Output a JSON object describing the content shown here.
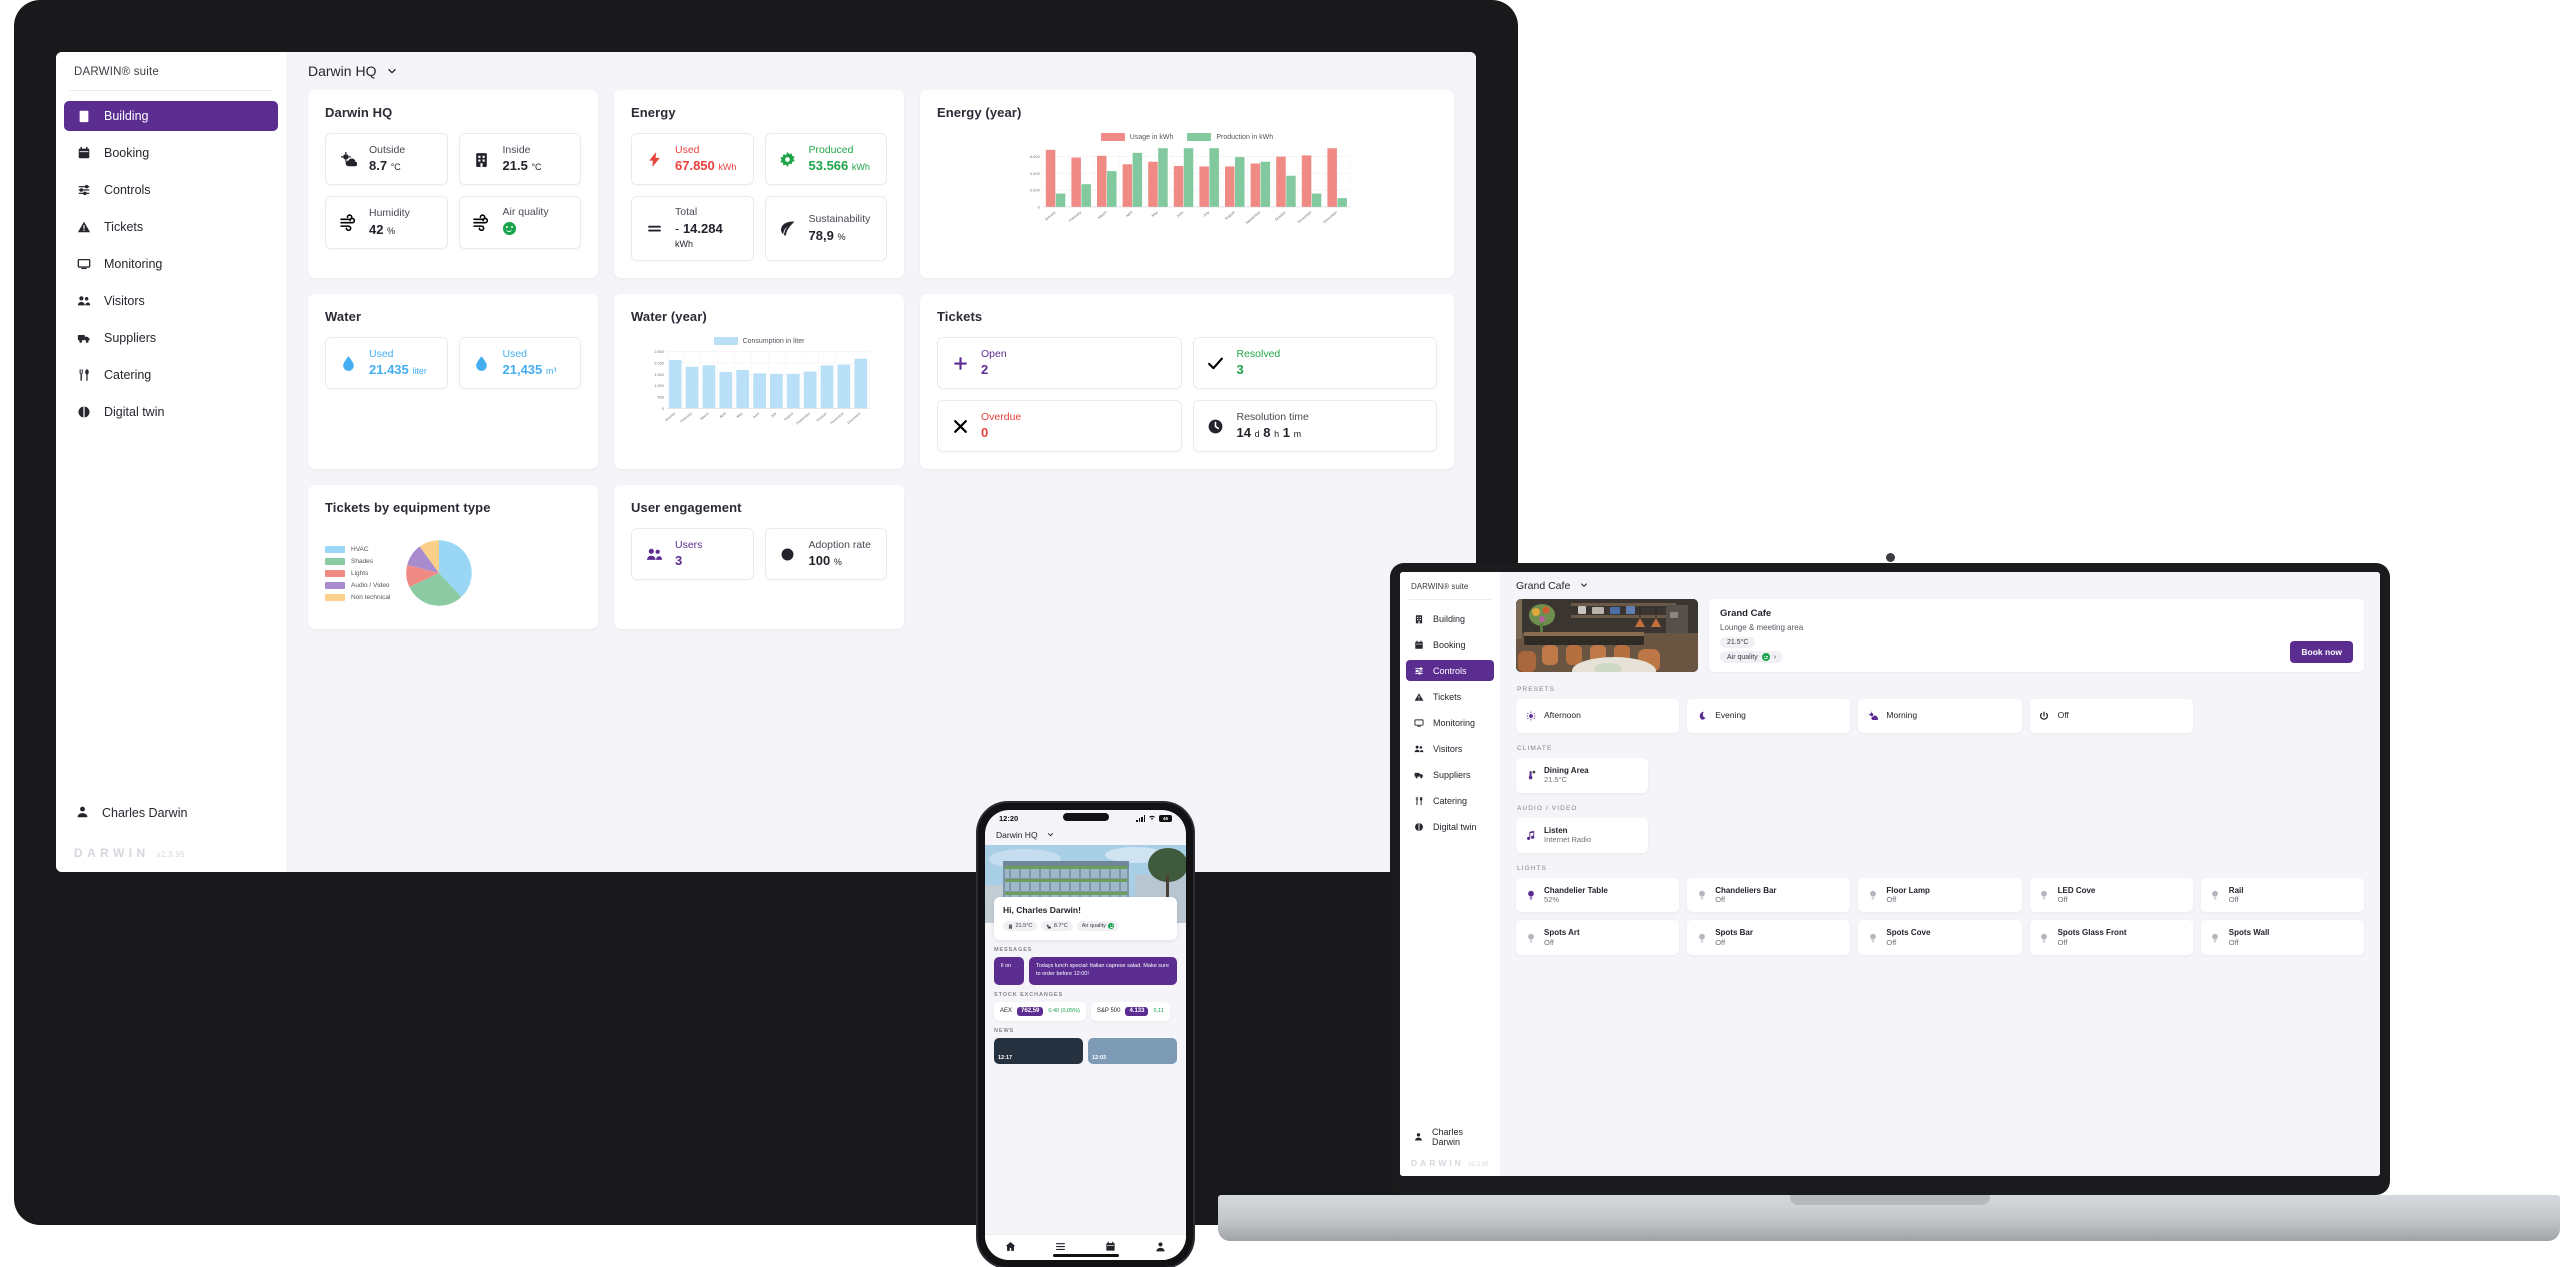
{
  "brand": {
    "suite": "DARWIN® suite",
    "watermark": "DARWIN",
    "version": "v2.3.95"
  },
  "desktop": {
    "nav": [
      {
        "label": "Building",
        "icon": "building-icon",
        "active": true
      },
      {
        "label": "Booking",
        "icon": "calendar-icon",
        "active": false
      },
      {
        "label": "Controls",
        "icon": "sliders-icon",
        "active": false
      },
      {
        "label": "Tickets",
        "icon": "warning-icon",
        "active": false
      },
      {
        "label": "Monitoring",
        "icon": "monitor-icon",
        "active": false
      },
      {
        "label": "Visitors",
        "icon": "users-icon",
        "active": false
      },
      {
        "label": "Suppliers",
        "icon": "truck-icon",
        "active": false
      },
      {
        "label": "Catering",
        "icon": "cutlery-icon",
        "active": false
      },
      {
        "label": "Digital twin",
        "icon": "digital-twin-icon",
        "active": false
      }
    ],
    "user": "Charles Darwin",
    "topbar": {
      "title": "Darwin HQ"
    },
    "cards": {
      "darwin_hq": {
        "title": "Darwin HQ",
        "tiles": [
          {
            "label": "Outside",
            "value": "8.7",
            "unit": "°C",
            "icon": "weather-icon",
            "color": "dark"
          },
          {
            "label": "Inside",
            "value": "21.5",
            "unit": "°C",
            "icon": "building-icon",
            "color": "dark"
          },
          {
            "label": "Humidity",
            "value": "42",
            "unit": "%",
            "icon": "wind-icon",
            "color": "dark"
          },
          {
            "label": "Air quality",
            "value": "",
            "unit": "",
            "icon": "wind-icon",
            "color": "dark",
            "badge": "smiley-green"
          }
        ]
      },
      "energy": {
        "title": "Energy",
        "tiles": [
          {
            "label": "Used",
            "value": "67.850",
            "unit": "kWh",
            "icon": "bolt-icon",
            "color": "red"
          },
          {
            "label": "Produced",
            "value": "53.566",
            "unit": "kWh",
            "icon": "gear-icon",
            "color": "green"
          },
          {
            "label": "Total",
            "value": "14.284",
            "unit": "kWh",
            "icon": "equals-icon",
            "color": "dark",
            "prefix": "-"
          },
          {
            "label": "Sustainability",
            "value": "78,9",
            "unit": "%",
            "icon": "leaf-icon",
            "color": "dark"
          }
        ]
      },
      "water": {
        "title": "Water",
        "tiles": [
          {
            "label": "Used",
            "value": "21.435",
            "unit": "liter",
            "icon": "droplet-icon",
            "color": "blue"
          },
          {
            "label": "Used",
            "value": "21,435",
            "unit": "m³",
            "icon": "droplet-icon",
            "color": "blue"
          }
        ]
      },
      "tickets": {
        "title": "Tickets",
        "tiles": [
          {
            "label": "Open",
            "value": "2",
            "unit": "",
            "icon": "plus-icon",
            "color": "purple"
          },
          {
            "label": "Resolved",
            "value": "3",
            "unit": "",
            "icon": "check-icon",
            "color": "green"
          },
          {
            "label": "Overdue",
            "value": "0",
            "unit": "",
            "icon": "cross-icon",
            "color": "red"
          },
          {
            "label": "Resolution time",
            "value": "14",
            "unit": "d 8 h 1 m",
            "icon": "clock-icon",
            "color": "dark",
            "composite": "14 d 8 h 1 m"
          }
        ]
      },
      "user_engagement": {
        "title": "User engagement",
        "tiles": [
          {
            "label": "Users",
            "value": "3",
            "unit": "",
            "icon": "users-icon",
            "color": "purple"
          },
          {
            "label": "Adoption rate",
            "value": "100",
            "unit": "%",
            "icon": "circle-icon",
            "color": "dark"
          }
        ]
      },
      "energy_year": {
        "title": "Energy (year)"
      },
      "water_year": {
        "title": "Water (year)"
      },
      "tickets_pie": {
        "title": "Tickets by equipment type"
      }
    }
  },
  "chart_data": [
    {
      "type": "bar",
      "title": "Energy (year)",
      "categories": [
        "January",
        "February",
        "March",
        "April",
        "May",
        "June",
        "July",
        "August",
        "September",
        "October",
        "November",
        "December"
      ],
      "series": [
        {
          "name": "Usage in kWh",
          "color": "#ef8a85",
          "values": [
            6750,
            5850,
            6050,
            5050,
            5350,
            4850,
            4800,
            4800,
            5150,
            5950,
            6100,
            6950
          ]
        },
        {
          "name": "Production in kWh",
          "color": "#83c99f",
          "values": [
            1600,
            2700,
            4250,
            6400,
            6950,
            6950,
            6950,
            5900,
            5350,
            3700,
            1600,
            1050
          ]
        }
      ],
      "ylabel": "",
      "xlabel": "",
      "yticks": [
        "0",
        "2.000",
        "4.000",
        "6.000"
      ],
      "ylim": [
        0,
        7000
      ],
      "grid": true,
      "legend_position": "top"
    },
    {
      "type": "bar",
      "title": "Water (year)",
      "categories": [
        "January",
        "February",
        "March",
        "April",
        "May",
        "June",
        "July",
        "August",
        "September",
        "October",
        "November",
        "December"
      ],
      "series": [
        {
          "name": "Consumption in liter",
          "color": "#b9e0f7",
          "values": [
            2130,
            1830,
            1900,
            1600,
            1690,
            1540,
            1520,
            1520,
            1620,
            1890,
            1930,
            2190
          ]
        }
      ],
      "ylabel": "",
      "xlabel": "",
      "yticks": [
        "0",
        "500",
        "1.000",
        "1.500",
        "2.000",
        "2.500"
      ],
      "ylim": [
        0,
        2500
      ],
      "grid": true,
      "legend_position": "top"
    },
    {
      "type": "pie",
      "title": "Tickets by equipment type",
      "categories": [
        "HVAC",
        "Shades",
        "Lights",
        "Audio / Video",
        "Non technical"
      ],
      "values": [
        38,
        30,
        11,
        11,
        10
      ],
      "colors": [
        "#9ad6f5",
        "#8ccaa4",
        "#ef8a85",
        "#a98ccd",
        "#fbd08a"
      ],
      "legend_position": "left"
    }
  ],
  "laptop": {
    "nav": [
      {
        "label": "Building",
        "icon": "building-icon",
        "active": false
      },
      {
        "label": "Booking",
        "icon": "calendar-icon",
        "active": false
      },
      {
        "label": "Controls",
        "icon": "sliders-icon",
        "active": true
      },
      {
        "label": "Tickets",
        "icon": "warning-icon",
        "active": false
      },
      {
        "label": "Monitoring",
        "icon": "monitor-icon",
        "active": false
      },
      {
        "label": "Visitors",
        "icon": "users-icon",
        "active": false
      },
      {
        "label": "Suppliers",
        "icon": "truck-icon",
        "active": false
      },
      {
        "label": "Catering",
        "icon": "cutlery-icon",
        "active": false
      },
      {
        "label": "Digital twin",
        "icon": "digital-twin-icon",
        "active": false
      }
    ],
    "user": "Charles Darwin",
    "topbar": {
      "title": "Grand Cafe"
    },
    "room": {
      "name": "Grand Cafe",
      "subtitle": "Lounge & meeting area",
      "temperature": "21.5°C",
      "air_quality_label": "Air quality",
      "book_label": "Book now"
    },
    "sections": [
      {
        "label": "PRESETS",
        "items": [
          {
            "name": "Afternoon",
            "value": "",
            "icon": "sun-icon"
          },
          {
            "name": "Evening",
            "value": "",
            "icon": "moon-icon"
          },
          {
            "name": "Morning",
            "value": "",
            "icon": "sunrise-icon"
          },
          {
            "name": "Off",
            "value": "",
            "icon": "power-icon"
          }
        ]
      },
      {
        "label": "CLIMATE",
        "items": [
          {
            "name": "Dining Area",
            "value": "21.5°C",
            "icon": "thermometer-icon"
          }
        ]
      },
      {
        "label": "AUDIO / VIDEO",
        "items": [
          {
            "name": "Listen",
            "value": "Internet Radio",
            "icon": "music-icon"
          }
        ]
      },
      {
        "label": "LIGHTS",
        "items": [
          {
            "name": "Chandelier Table",
            "value": "52%",
            "icon": "bulb-icon",
            "on": true
          },
          {
            "name": "Chandeliers Bar",
            "value": "Off",
            "icon": "bulb-icon",
            "on": false
          },
          {
            "name": "Floor Lamp",
            "value": "Off",
            "icon": "bulb-icon",
            "on": false
          },
          {
            "name": "LED Cove",
            "value": "Off",
            "icon": "bulb-icon",
            "on": false
          },
          {
            "name": "Rail",
            "value": "Off",
            "icon": "bulb-icon",
            "on": false
          },
          {
            "name": "Spots Art",
            "value": "Off",
            "icon": "bulb-icon",
            "on": false
          },
          {
            "name": "Spots Bar",
            "value": "Off",
            "icon": "bulb-icon",
            "on": false
          },
          {
            "name": "Spots Cove",
            "value": "Off",
            "icon": "bulb-icon",
            "on": false
          },
          {
            "name": "Spots Glass Front",
            "value": "Off",
            "icon": "bulb-icon",
            "on": false
          },
          {
            "name": "Spots Wall",
            "value": "Off",
            "icon": "bulb-icon",
            "on": false
          }
        ]
      }
    ]
  },
  "phone": {
    "status": {
      "time": "12:20",
      "battery": "46"
    },
    "topbar": {
      "title": "Darwin HQ"
    },
    "greeting": "Hi, Charles Darwin!",
    "chips": [
      {
        "label": "21.5°C",
        "icon": "building-icon"
      },
      {
        "label": "8.7°C",
        "icon": "weather-icon"
      },
      {
        "label": "Air quality",
        "icon": "smiley-green"
      }
    ],
    "messages_label": "MESSAGES",
    "messages": [
      {
        "text": "ll on",
        "partial": true
      },
      {
        "text": "Todays lunch special: Italian caprese salad. Make sure to order before 12:00!",
        "partial": false
      }
    ],
    "stocks_label": "STOCK EXCHANGES",
    "stocks": [
      {
        "name": "AEX",
        "price": "762,59",
        "change": "0,40 (0,05%)"
      },
      {
        "name": "S&P 500",
        "price": "4.133",
        "change": "0,11"
      }
    ],
    "news_label": "NEWS",
    "news": [
      {
        "time": "12:17"
      },
      {
        "time": "12:03"
      }
    ],
    "tabs": [
      "home-icon",
      "list-icon",
      "calendar-icon",
      "profile-icon"
    ]
  },
  "colors": {
    "accent": "#5b2d91",
    "red": "#e8413c",
    "green": "#20a44a",
    "blue": "#43aef0",
    "usage_bar": "#ef8a85",
    "production_bar": "#83c99f",
    "water_bar": "#b9e0f7"
  }
}
